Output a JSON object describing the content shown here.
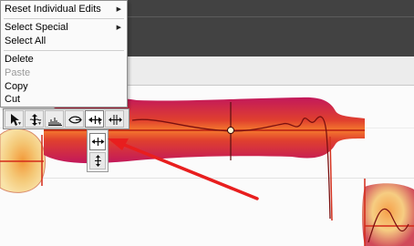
{
  "context_menu": {
    "items": [
      {
        "label": "Reset Individual Edits",
        "has_submenu": true,
        "disabled": false
      },
      {
        "label": "Select Special",
        "has_submenu": true,
        "disabled": false
      },
      {
        "label": "Select All",
        "has_submenu": false,
        "disabled": false
      },
      {
        "label": "Delete",
        "has_submenu": false,
        "disabled": false
      },
      {
        "label": "Paste",
        "has_submenu": false,
        "disabled": true
      },
      {
        "label": "Copy",
        "has_submenu": false,
        "disabled": false
      },
      {
        "label": "Cut",
        "has_submenu": false,
        "disabled": false
      }
    ],
    "submenu_glyph": "▶"
  },
  "toolbar": {
    "tools": [
      {
        "icon": "arrow-pointer-icon",
        "active": false
      },
      {
        "icon": "pitch-tool-icon",
        "active": false
      },
      {
        "icon": "formant-tool-icon",
        "active": false
      },
      {
        "icon": "amplitude-tool-icon",
        "active": false
      },
      {
        "icon": "time-tool-icon",
        "active": true
      },
      {
        "icon": "separation-tool-icon",
        "active": false
      }
    ]
  },
  "flyout": {
    "tools": [
      {
        "icon": "time-tool-icon",
        "selected": true
      },
      {
        "icon": "time-stretch-vertical-icon",
        "selected": false
      }
    ]
  },
  "colors": {
    "menu_bg": "#fafafa",
    "toolbar_bg": "#e4e4e4",
    "track_bg": "#424242",
    "note_red": "#d93a2b",
    "note_magenta": "#c2185b",
    "note_yellow": "#f6d67a",
    "annotation_arrow": "#e81e1e"
  }
}
